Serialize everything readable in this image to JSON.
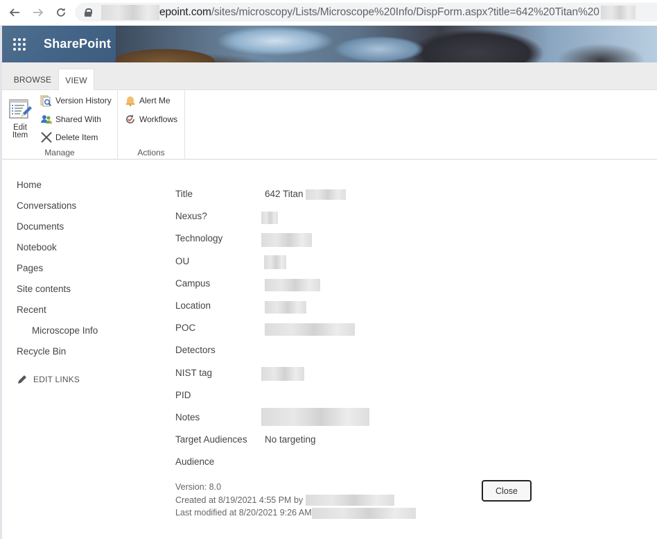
{
  "browser": {
    "url_visible": "epoint.com/sites/microscopy/Lists/Microscope%20Info/DispForm.aspx?title=642%20Titan%20",
    "url_host_suffix": "epoint.com",
    "url_path": "/sites/microscopy/Lists/Microscope%20Info/DispForm.aspx?title=642%20Titan%20",
    "back_icon": "arrow-left-icon",
    "forward_icon": "arrow-right-icon",
    "reload_icon": "reload-icon",
    "lock_icon": "lock-icon"
  },
  "suite_bar": {
    "brand": "SharePoint",
    "app_launcher_icon": "waffle-icon",
    "brand_color": "#46678a"
  },
  "ribbon": {
    "tabs": [
      {
        "label": "BROWSE",
        "active": false
      },
      {
        "label": "VIEW",
        "active": true
      }
    ],
    "groups": {
      "manage": {
        "label": "Manage",
        "edit_item": "Edit Item",
        "edit_item_line1": "Edit",
        "edit_item_line2": "Item",
        "version_history": "Version History",
        "shared_with": "Shared With",
        "delete_item": "Delete Item"
      },
      "actions": {
        "label": "Actions",
        "alert_me": "Alert Me",
        "workflows": "Workflows"
      }
    }
  },
  "left_nav": {
    "items": [
      {
        "label": "Home"
      },
      {
        "label": "Conversations"
      },
      {
        "label": "Documents"
      },
      {
        "label": "Notebook"
      },
      {
        "label": "Pages"
      },
      {
        "label": "Site contents"
      },
      {
        "label": "Recent"
      },
      {
        "label": "Microscope Info",
        "sub": true
      },
      {
        "label": "Recycle Bin"
      }
    ],
    "edit_links": "EDIT LINKS"
  },
  "form": {
    "fields": [
      {
        "label": "Title",
        "value": "642 Titan",
        "redacted": true
      },
      {
        "label": "Nexus?",
        "value": "",
        "redacted": true
      },
      {
        "label": "Technology",
        "value": "",
        "redacted": true
      },
      {
        "label": "OU",
        "value": "",
        "redacted": true
      },
      {
        "label": "Campus",
        "value": "",
        "redacted": true
      },
      {
        "label": "Location",
        "value": "",
        "redacted": true
      },
      {
        "label": "POC",
        "value": "",
        "redacted": true
      },
      {
        "label": "Detectors",
        "value": ""
      },
      {
        "label": "NIST tag",
        "value": "",
        "redacted": true
      },
      {
        "label": "PID",
        "value": ""
      },
      {
        "label": "Notes",
        "value": "",
        "redacted": true
      },
      {
        "label": "Target Audiences",
        "value": "No targeting"
      },
      {
        "label": "Audience",
        "value": ""
      }
    ]
  },
  "footer": {
    "version": "Version: 8.0",
    "created": "Created at 8/19/2021 4:55 PM  by",
    "modified": "Last modified at 8/20/2021 9:26 AM",
    "close_label": "Close"
  }
}
